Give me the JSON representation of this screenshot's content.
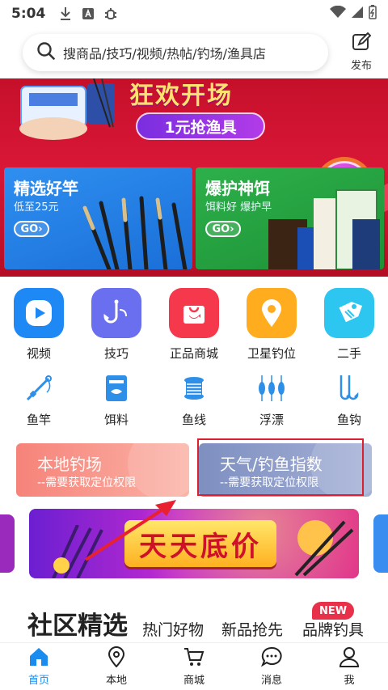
{
  "status_bar": {
    "time": "5:04",
    "icons": [
      "download-icon",
      "a-box-icon",
      "bug-icon",
      "wifi-icon",
      "signal-icon",
      "battery-icon"
    ]
  },
  "search": {
    "placeholder": "搜商品/技巧/视频/热帖/钓场/渔具店",
    "publish_label": "发布"
  },
  "banner": {
    "title": "狂欢开场",
    "pill": "1元抢渔具",
    "go": "GO",
    "cards": [
      {
        "title": "精选好竿",
        "subtitle": "低至25元",
        "go": "GO"
      },
      {
        "title": "爆护神饵",
        "subtitle": "饵料好 爆护早",
        "go": "GO"
      }
    ]
  },
  "primary_grid": [
    {
      "label": "视频",
      "icon": "play-icon",
      "color": "#1e88f5"
    },
    {
      "label": "技巧",
      "icon": "fish-hook-icon",
      "color": "#6a6ff0"
    },
    {
      "label": "正品商城",
      "icon": "shopping-bag-icon",
      "color": "#f5384b"
    },
    {
      "label": "卫星钓位",
      "icon": "map-pin-icon",
      "color": "#ffad1f"
    },
    {
      "label": "二手",
      "icon": "price-tag-icon",
      "color": "#2cc6f0"
    }
  ],
  "secondary_grid": [
    {
      "label": "鱼竿",
      "icon": "fishing-rod-icon"
    },
    {
      "label": "饵料",
      "icon": "bait-box-icon"
    },
    {
      "label": "鱼线",
      "icon": "fishing-line-spool-icon"
    },
    {
      "label": "浮漂",
      "icon": "float-bobber-icon"
    },
    {
      "label": "鱼钩",
      "icon": "fish-hooks-icon"
    }
  ],
  "location_cards": [
    {
      "title": "本地钓场",
      "subtitle": "--需要获取定位权限"
    },
    {
      "title": "天气/钓鱼指数",
      "subtitle": "--需要获取定位权限"
    }
  ],
  "promo": {
    "label": "天天底价"
  },
  "community": {
    "title": "社区精选",
    "tabs": [
      "热门好物",
      "新品抢先",
      "品牌钓具"
    ],
    "new_badge": "NEW"
  },
  "bottom_nav": [
    {
      "label": "首页",
      "icon": "home-icon",
      "active": true
    },
    {
      "label": "本地",
      "icon": "location-icon",
      "active": false
    },
    {
      "label": "商城",
      "icon": "cart-icon",
      "active": false
    },
    {
      "label": "消息",
      "icon": "message-icon",
      "active": false
    },
    {
      "label": "我",
      "icon": "user-icon",
      "active": false
    }
  ],
  "colors": {
    "accent": "#1a8cf0",
    "highlight_border": "#d82030",
    "banner_red": "#c5102a"
  }
}
